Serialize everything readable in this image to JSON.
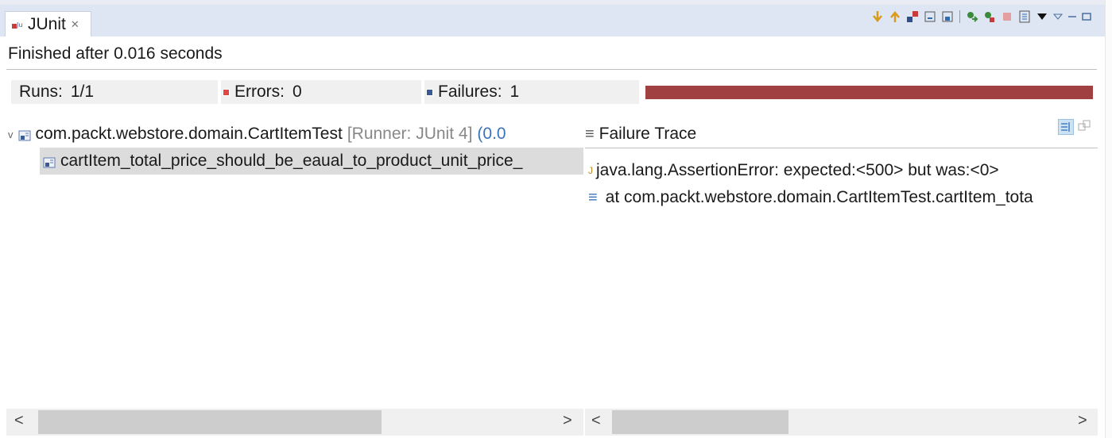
{
  "tab": {
    "title": "JUnit",
    "close_glyph": "✕"
  },
  "toolbar": {
    "icons": [
      "next-failure-icon",
      "previous-failure-icon",
      "show-failures-only-icon",
      "scroll-lock-icon",
      "show-skipped-icon",
      "rerun-icon",
      "rerun-failed-first-icon",
      "stop-icon",
      "test-run-history-icon",
      "menu-dropdown-icon",
      "view-menu-icon",
      "minimize-icon",
      "maximize-icon"
    ]
  },
  "status": "Finished after 0.016 seconds",
  "counters": {
    "runs_label": "Runs:",
    "runs_value": "1/1",
    "errors_label": "Errors:",
    "errors_value": "0",
    "failures_label": "Failures:",
    "failures_value": "1"
  },
  "progress": {
    "fraction": 1.0,
    "color": "#a04040"
  },
  "tree": {
    "suite_name": "com.packt.webstore.domain.CartItemTest",
    "suite_runner": "[Runner: JUnit 4]",
    "suite_time": "(0.0",
    "test_name": "cartItem_total_price_should_be_eaual_to_product_unit_price_"
  },
  "trace": {
    "title": "Failure Trace",
    "line1": "java.lang.AssertionError: expected:<500> but was:<0>",
    "line2": "at com.packt.webstore.domain.CartItemTest.cartItem_tota"
  },
  "scroll": {
    "left_arrow": "<",
    "right_arrow": ">"
  }
}
